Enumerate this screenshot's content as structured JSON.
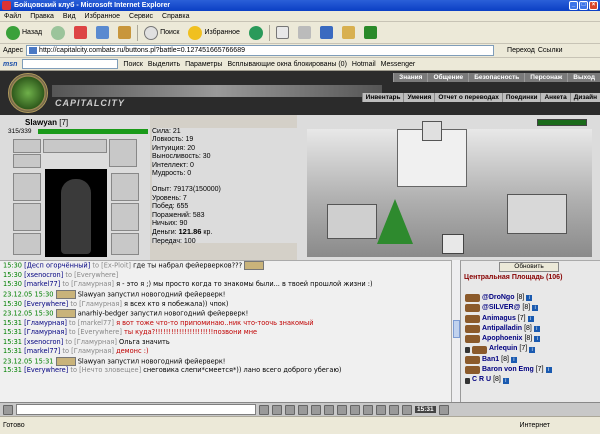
{
  "window": {
    "title": "Бойцовский клуб - Microsoft Internet Explorer"
  },
  "menu": [
    "Файл",
    "Правка",
    "Вид",
    "Избранное",
    "Сервис",
    "Справка"
  ],
  "toolbar": {
    "back": "Назад",
    "search": "Поиск",
    "favorites": "Избранное"
  },
  "address": {
    "label": "Адрес",
    "url": "http://capitalcity.combats.ru/buttons.pl?battle=0.127451665766689",
    "go": "Переход",
    "links": "Ссылки"
  },
  "msnbar": {
    "logo": "msn",
    "search": "Поиск",
    "highlight": "Выделить",
    "params": "Параметры",
    "blocked": "Всплывающие окна блокированы (0)",
    "hotmail": "Hotmail",
    "messenger": "Messenger"
  },
  "game": {
    "logo": "CAPITALCITY",
    "nav": [
      "Знания",
      "Общение",
      "Безопасность",
      "Персонаж",
      "Выход"
    ],
    "subnav": [
      "Инвентарь",
      "Умения",
      "Отчет о переводах",
      "Поединки",
      "Анкета",
      "Дизайн"
    ]
  },
  "player": {
    "name": "Slawyan",
    "level": "[7]",
    "hp": "315/339"
  },
  "stats": {
    "strength": "Сила: 21",
    "agility": "Ловкость: 19",
    "intuition": "Интуиция: 20",
    "endurance": "Выносливость: 30",
    "intellect": "Интеллект: 0",
    "wisdom": "Мудрость: 0",
    "exp": "Опыт: 79173(150000)",
    "level": "Уровень: 7",
    "wins": "Побед: 655",
    "losses": "Поражений: 583",
    "draws": "Ничьих: 90",
    "money_label": "Деньги:",
    "money": "121.86",
    "money_unit": "кр.",
    "transfers": "Передач: 100"
  },
  "chat": [
    {
      "t": "15:30",
      "n": "[Десп огорчённый]",
      "to": "to [Ex-Ploit]",
      "m": "где ты набрал фейерверков???"
    },
    {
      "t": "15:30",
      "n": "[xsenocron]",
      "to": "to [Everywhere]",
      "m": ""
    },
    {
      "t": "15:30",
      "n": "[markel77]",
      "to": "to [Гламурная]",
      "m": "я - это я ;) мы просто когда то знакомы были... в твоей прошлой жизни :)"
    },
    {
      "t": "23.12.05 15:30",
      "n": "",
      "to": "",
      "m": "Slawyan запустил новогодний фейерверк!"
    },
    {
      "t": "15:30",
      "n": "[Everywhere]",
      "to": "to [Гламурная]",
      "m": "я всех кто я побежала)) чпок)"
    },
    {
      "t": "23.12.05 15:30",
      "n": "",
      "to": "",
      "m": "anarhiy-bedger запустил новогодний фейерверк!"
    },
    {
      "t": "15:31",
      "n": "[Гламурная]",
      "to": "to [markel77]",
      "m": "я вот тоже что-то припоминаю..ник что-тоочь знакомый"
    },
    {
      "t": "15:31",
      "n": "[Гламурная]",
      "to": "to [Everywhere]",
      "m": "ты куда?!!!!!!!!!!!!!!!!!!!!!!позвони мне"
    },
    {
      "t": "15:31",
      "n": "[xsenocron]",
      "to": "to [Гламурная]",
      "m": "Ольга значить"
    },
    {
      "t": "15:31",
      "n": "[markel77]",
      "to": "to [Гламурная]",
      "m": "демонс :)"
    },
    {
      "t": "23.12.05 15:31",
      "n": "",
      "to": "",
      "m": "Slawyan запустил новогодний фейерверк!"
    },
    {
      "t": "15:31",
      "n": "[Everywhere]",
      "to": "to [Нечто зловещее]",
      "m": "снеговика слепи*смеется*)) лано всего доброго убегаю)"
    }
  ],
  "who": {
    "update": "Обновить",
    "title": "Центральная Площадь (106)",
    "users": [
      {
        "n": "@DroNgo",
        "l": "[8]"
      },
      {
        "n": "@SILVER@",
        "l": "[8]"
      },
      {
        "n": "Animagus",
        "l": "[7]"
      },
      {
        "n": "Antipalladin",
        "l": "[8]"
      },
      {
        "n": "Apophoenix",
        "l": "[8]"
      },
      {
        "n": "Arlequin",
        "l": "[7]"
      },
      {
        "n": "Ban1",
        "l": "[8]"
      },
      {
        "n": "Baron von Emg",
        "l": "[7]"
      },
      {
        "n": "C R U",
        "l": "[8]"
      }
    ]
  },
  "bottom": {
    "clock": "15:31"
  },
  "status": {
    "left": "Готово",
    "zone": "Интернет"
  }
}
